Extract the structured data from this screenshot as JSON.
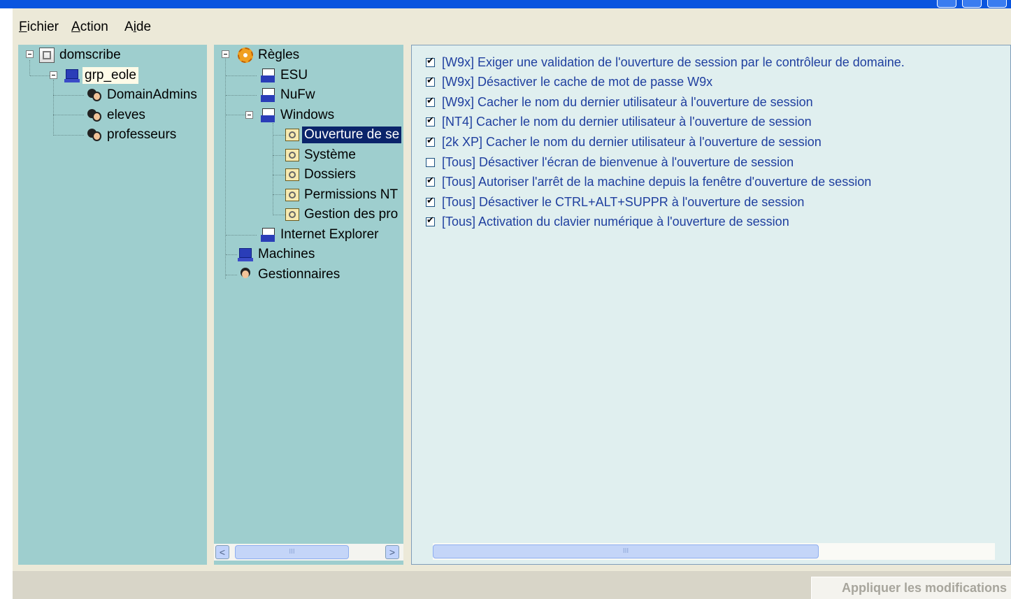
{
  "menu": {
    "fichier": "Fichier",
    "action": "Action",
    "aide": "Aide"
  },
  "tree_groups": {
    "root": "domscribe",
    "group": "grp_eole",
    "members": [
      "DomainAdmins",
      "eleves",
      "professeurs"
    ]
  },
  "tree_rules": {
    "root": "Règles",
    "esu": "ESU",
    "nufw": "NuFw",
    "windows": "Windows",
    "windows_children": [
      "Ouverture de se",
      "Système",
      "Dossiers",
      "Permissions NT",
      "Gestion des pro"
    ],
    "ie": "Internet Explorer",
    "machines": "Machines",
    "gestionnaires": "Gestionnaires",
    "selected": "Ouverture de se"
  },
  "options": [
    {
      "label": "[W9x] Exiger une validation de l'ouverture de session par le contrôleur de domaine.",
      "checked": true
    },
    {
      "label": "[W9x] Désactiver le cache de mot de passe W9x",
      "checked": true
    },
    {
      "label": "[W9x] Cacher le nom du dernier utilisateur à l'ouverture de session",
      "checked": true
    },
    {
      "label": "[NT4] Cacher le nom du dernier utilisateur à l'ouverture de session",
      "checked": true
    },
    {
      "label": "[2k XP] Cacher le nom du dernier utilisateur à l'ouverture de session",
      "checked": true
    },
    {
      "label": "[Tous] Désactiver l'écran de bienvenue à l'ouverture de session",
      "checked": false
    },
    {
      "label": "[Tous] Autoriser l'arrêt de la machine depuis la fenêtre d'ouverture de session",
      "checked": true
    },
    {
      "label": "[Tous] Désactiver le CTRL+ALT+SUPPR à l'ouverture de session",
      "checked": true
    },
    {
      "label": "[Tous] Activation du clavier numérique à l'ouverture de session",
      "checked": true
    }
  ],
  "apply_label": "Appliquer les modifications",
  "scroll": {
    "left_glyph": "<",
    "right_glyph": ">",
    "thumb_glyph": "III"
  },
  "colors": {
    "pane_bg": "#9ecece",
    "content_bg": "#e0efef",
    "option_text": "#1f3f9f",
    "title_blue": "#0a55df"
  }
}
